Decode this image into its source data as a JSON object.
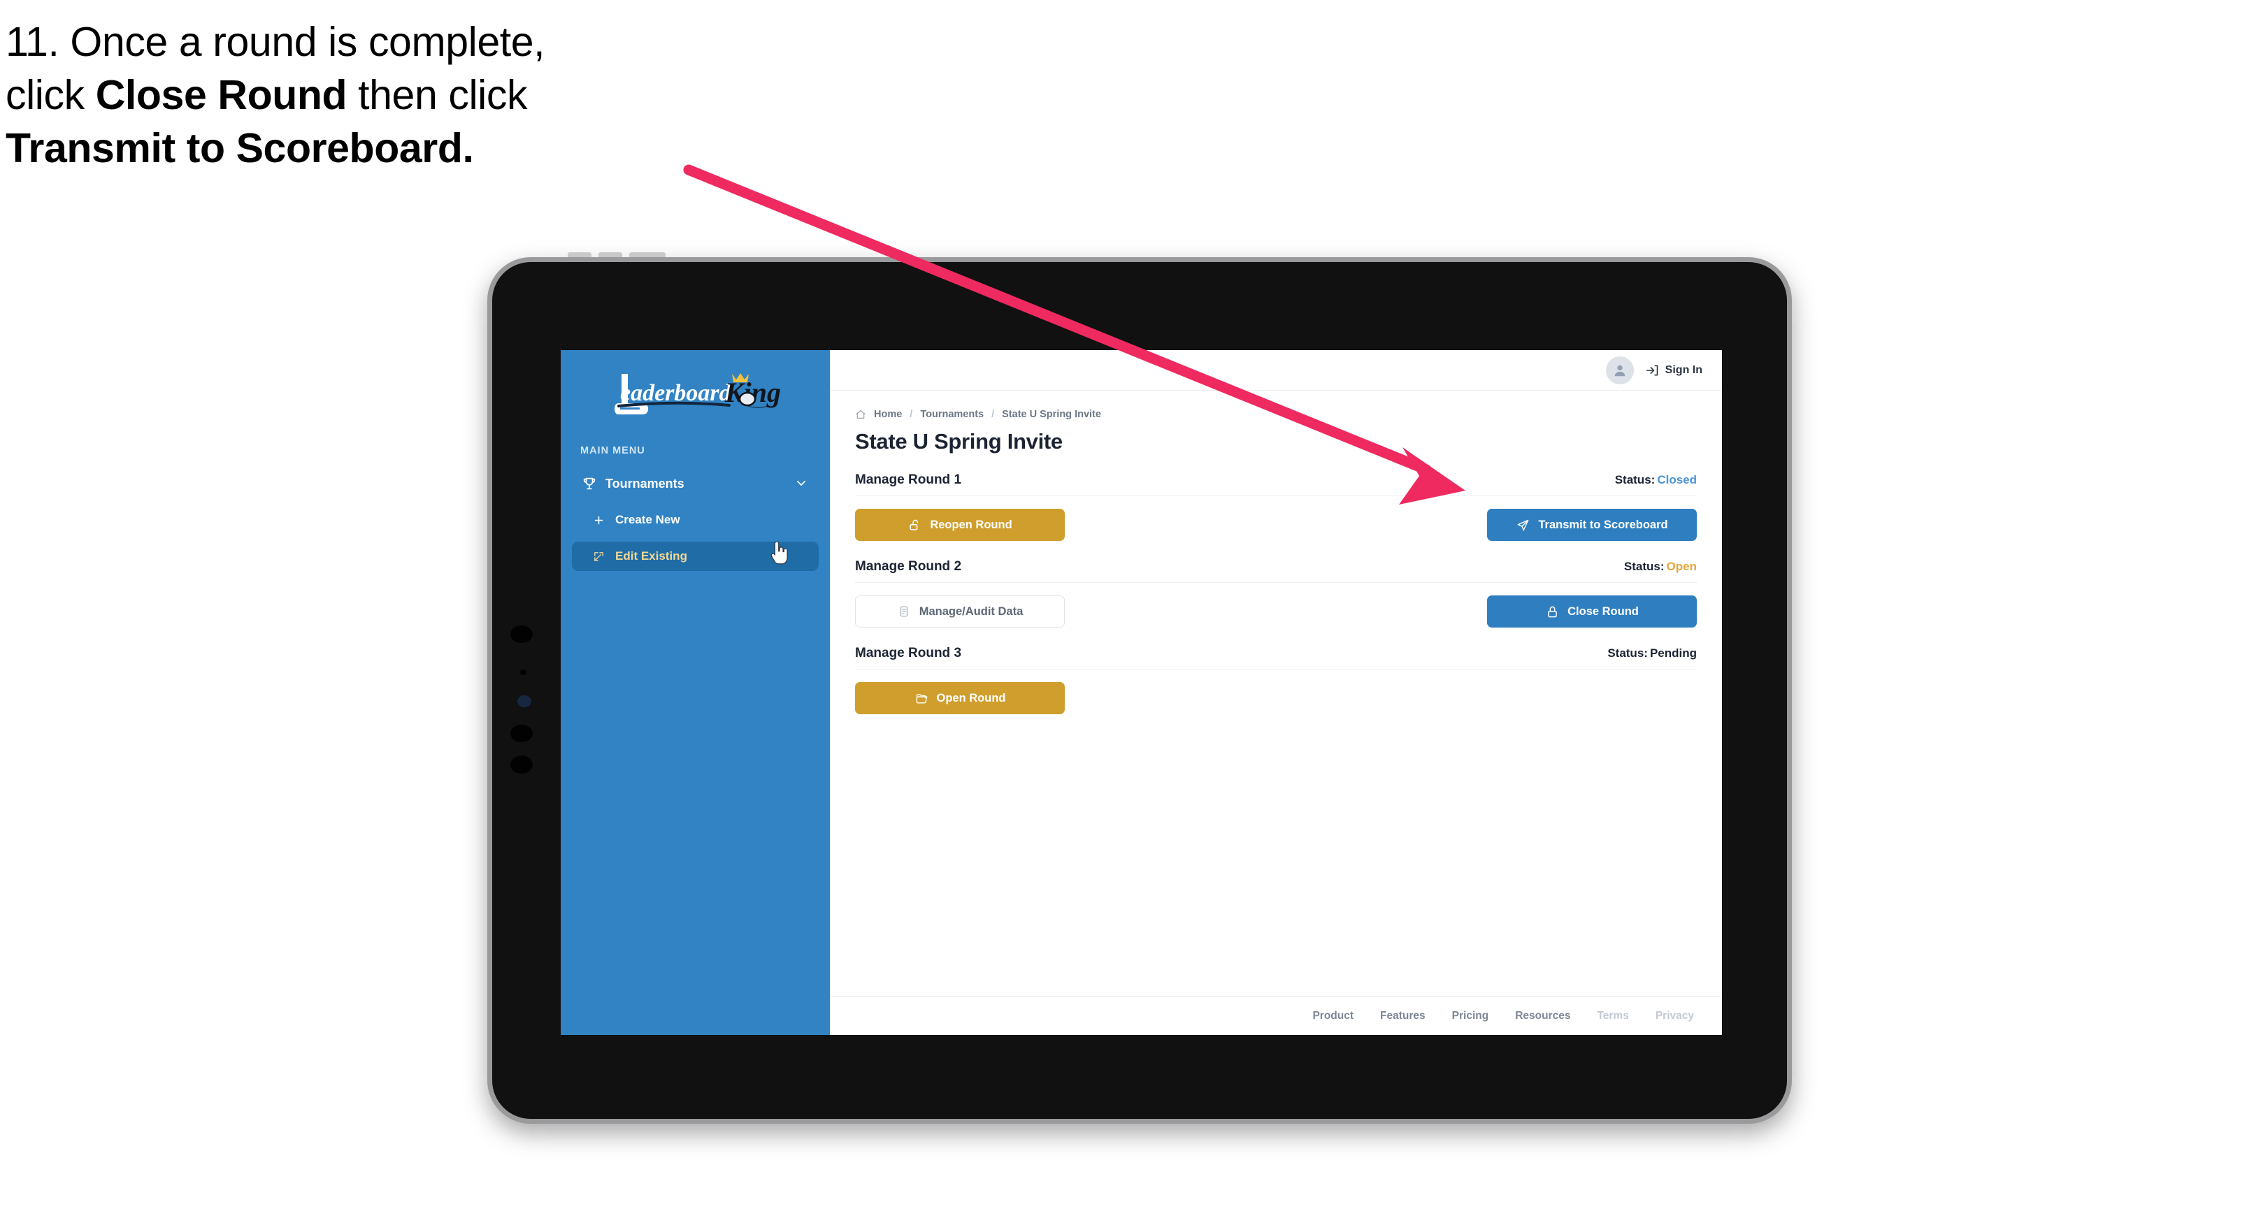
{
  "caption": {
    "line1_prefix": "11. Once a round is complete,",
    "line2_prefix": "click ",
    "line2_bold": "Close Round",
    "line2_suffix": " then click",
    "line3_bold": "Transmit to Scoreboard."
  },
  "colors": {
    "sidebar_blue": "#3183c4",
    "sidebar_active_blue": "#1f6ca7",
    "sidebar_active_text": "#f2d795",
    "gold": "#cf9e2c",
    "blue": "#2f7fc0",
    "status_closed": "#4a94d8",
    "status_open": "#e8a43a",
    "status_pending": "#1c2433",
    "arrow_pink": "#ef2a60"
  },
  "sidebar": {
    "logo_text_main": "Leaderboard",
    "logo_text_accent": "King",
    "menu_label": "MAIN MENU",
    "items": [
      {
        "label": "Tournaments",
        "icon": "trophy-icon",
        "chevron": "chevron-down-icon"
      },
      {
        "label": "Create New",
        "icon": "plus-icon"
      },
      {
        "label": "Edit Existing",
        "icon": "edit-square-icon",
        "active": true
      }
    ]
  },
  "topbar": {
    "avatar_icon": "user-avatar-icon",
    "signin_icon": "sign-in-arrow-icon",
    "signin_label": "Sign In"
  },
  "breadcrumb": {
    "home_icon": "home-icon",
    "items": [
      "Home",
      "Tournaments",
      "State U Spring Invite"
    ],
    "separator": "/"
  },
  "page": {
    "title": "State U Spring Invite"
  },
  "rounds": [
    {
      "title": "Manage Round 1",
      "status_label": "Status:",
      "status_value": "Closed",
      "status_color": "#4a94d8",
      "left_button": {
        "label": "Reopen Round",
        "icon": "unlock-icon",
        "style": "gold"
      },
      "right_button": {
        "label": "Transmit to Scoreboard",
        "icon": "paper-plane-icon",
        "style": "blue"
      }
    },
    {
      "title": "Manage Round 2",
      "status_label": "Status:",
      "status_value": "Open",
      "status_color": "#e8a43a",
      "left_button": {
        "label": "Manage/Audit Data",
        "icon": "clipboard-icon",
        "style": "ghost"
      },
      "right_button": {
        "label": "Close Round",
        "icon": "lock-icon",
        "style": "blue"
      }
    },
    {
      "title": "Manage Round 3",
      "status_label": "Status:",
      "status_value": "Pending",
      "status_color": "#1c2433",
      "left_button": {
        "label": "Open Round",
        "icon": "folder-open-icon",
        "style": "gold"
      },
      "right_button": null
    }
  ],
  "footer": {
    "links": [
      {
        "label": "Product",
        "dim": false
      },
      {
        "label": "Features",
        "dim": false
      },
      {
        "label": "Pricing",
        "dim": false
      },
      {
        "label": "Resources",
        "dim": false
      },
      {
        "label": "Terms",
        "dim": true
      },
      {
        "label": "Privacy",
        "dim": true
      }
    ]
  }
}
